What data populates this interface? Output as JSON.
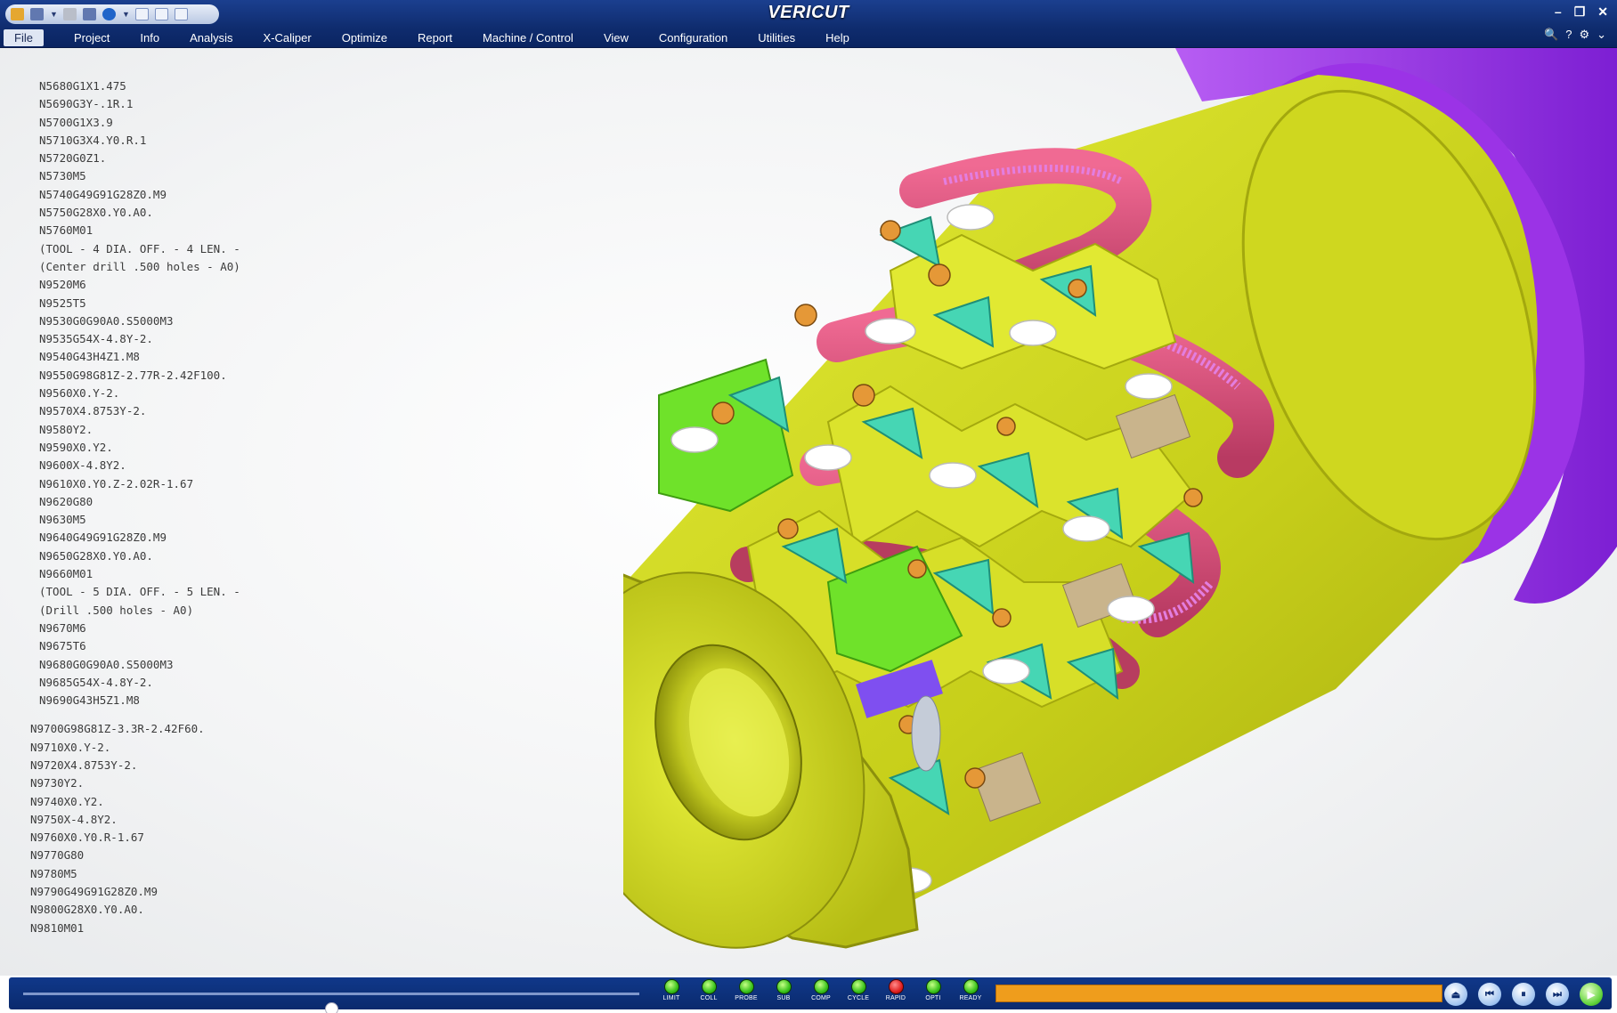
{
  "app": {
    "title": "VERICUT",
    "window_controls": [
      "–",
      "❐",
      "✕"
    ]
  },
  "menu": {
    "items": [
      "File",
      "Project",
      "Info",
      "Analysis",
      "X-Caliper",
      "Optimize",
      "Report",
      "Machine / Control",
      "View",
      "Configuration",
      "Utilities",
      "Help"
    ],
    "active": "File"
  },
  "help_tools": {
    "search": "🔍",
    "help": "?",
    "settings": "⚙",
    "expand": "⌄"
  },
  "nc_program": {
    "block1": [
      "N5680G1X1.475",
      "N5690G3Y-.1R.1",
      "N5700G1X3.9",
      "N5710G3X4.Y0.R.1",
      "N5720G0Z1.",
      "N5730M5",
      "N5740G49G91G28Z0.M9",
      "N5750G28X0.Y0.A0.",
      "N5760M01",
      "(TOOL - 4 DIA. OFF. - 4 LEN. -",
      "(Center drill .500 holes - A0)",
      "N9520M6",
      "N9525T5",
      "N9530G0G90A0.S5000M3",
      "N9535G54X-4.8Y-2.",
      "N9540G43H4Z1.M8",
      "N9550G98G81Z-2.77R-2.42F100.",
      "N9560X0.Y-2.",
      "N9570X4.8753Y-2.",
      "N9580Y2.",
      "N9590X0.Y2.",
      "N9600X-4.8Y2.",
      "N9610X0.Y0.Z-2.02R-1.67",
      "N9620G80",
      "N9630M5",
      "N9640G49G91G28Z0.M9",
      "N9650G28X0.Y0.A0.",
      "N9660M01",
      "(TOOL - 5 DIA. OFF. - 5 LEN. -",
      "(Drill .500 holes - A0)",
      "N9670M6",
      "N9675T6",
      "N9680G0G90A0.S5000M3",
      "N9685G54X-4.8Y-2.",
      "N9690G43H5Z1.M8"
    ],
    "block2": [
      "N9700G98G81Z-3.3R-2.42F60.",
      "N9710X0.Y-2.",
      "N9720X4.8753Y-2.",
      "N9730Y2.",
      "N9740X0.Y2.",
      "N9750X-4.8Y2.",
      "N9760X0.Y0.R-1.67",
      "N9770G80",
      "N9780M5",
      "N9790G49G91G28Z0.M9",
      "N9800G28X0.Y0.A0.",
      "N9810M01"
    ]
  },
  "status_leds": [
    {
      "label": "LIMIT",
      "state": "green"
    },
    {
      "label": "COLL",
      "state": "green"
    },
    {
      "label": "PROBE",
      "state": "green"
    },
    {
      "label": "SUB",
      "state": "green"
    },
    {
      "label": "COMP",
      "state": "green"
    },
    {
      "label": "CYCLE",
      "state": "green"
    },
    {
      "label": "RAPID",
      "state": "red"
    },
    {
      "label": "OPTI",
      "state": "green"
    },
    {
      "label": "READY",
      "state": "green"
    }
  ],
  "simulation": {
    "speed_slider_fraction": 0.5,
    "progress_fraction": 1.0
  },
  "playback_controls": [
    "reset",
    "rewind",
    "pause",
    "step",
    "play"
  ],
  "colors": {
    "titlebar": "#0f2c6e",
    "progress": "#ef9d1c",
    "part_yellow": "#c9d21f",
    "fixture_purple": "#9d35e6",
    "coolant_pink": "#d9557e",
    "drill_cyan": "#46d6b4",
    "cut_green": "#6fe22a"
  }
}
